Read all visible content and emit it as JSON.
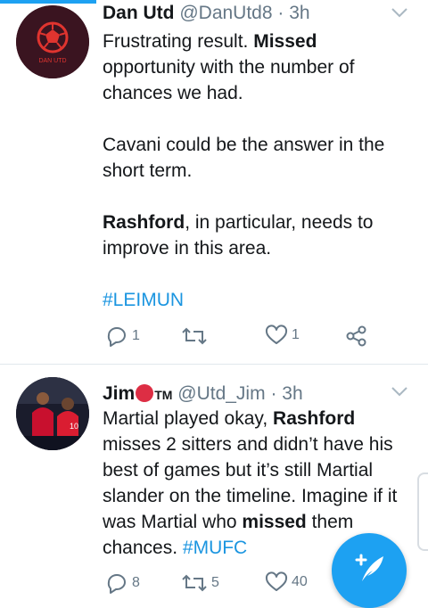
{
  "tweets": [
    {
      "name": "Dan Utd",
      "handle": "@DanUtd8",
      "time": "· 3h",
      "avatar_label": "DAN UTD",
      "body": {
        "p1_a": "Frustrating result. ",
        "p1_b": "Missed",
        "p1_c": " opportunity with the number of chances we had.",
        "p2": "Cavani could be the answer in the short term.",
        "p3_a": "Rashford",
        "p3_b": ", in particular, needs to improve in this area.",
        "hashtag": "#LEIMUN"
      },
      "reply_count": "1",
      "retweet_count": "",
      "like_count": "1"
    },
    {
      "name": "Jim",
      "name_badge": "TM",
      "handle": "@Utd_Jim",
      "time": "· 3h",
      "body": {
        "a": "Martial played okay, ",
        "b": "Rashford",
        "c": " misses 2 sitters and didn’t have his best of games but it’s still Martial slander on the timeline. Imagine if it was Martial who ",
        "d": "missed",
        "e": " them chances. ",
        "hashtag": "#MUFC"
      },
      "reply_count": "8",
      "retweet_count": "5",
      "like_count": "40"
    }
  ],
  "colors": {
    "accent": "#1da1f2",
    "link": "#1b95e0",
    "muted": "#657786"
  },
  "compose_button": {
    "icon": "compose-tweet-icon"
  }
}
